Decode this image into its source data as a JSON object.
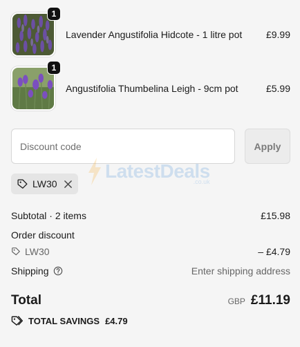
{
  "line_items": [
    {
      "name": "Lavender Angustifolia Hidcote - 1 litre pot",
      "price": "£9.99",
      "quantity": "1",
      "image": "lavender-hidcote-photo"
    },
    {
      "name": "Angustifolia Thumbelina Leigh - 9cm pot",
      "price": "£5.99",
      "quantity": "1",
      "image": "lavender-thumbelina-photo"
    }
  ],
  "discount": {
    "placeholder": "Discount code",
    "value": "",
    "apply_label": "Apply",
    "applied_code": "LW30"
  },
  "summary": {
    "subtotal_label": "Subtotal · 2 items",
    "subtotal_value": "£15.98",
    "order_discount_label": "Order discount",
    "order_discount_code": "LW30",
    "order_discount_value": "– £4.79",
    "shipping_label": "Shipping",
    "shipping_value": "Enter shipping address",
    "total_label": "Total",
    "currency": "GBP",
    "total_value": "£11.19",
    "savings_label": "TOTAL SAVINGS",
    "savings_value": "£4.79"
  },
  "watermark": {
    "text": "LatestDeals",
    "sub": ".co.uk"
  },
  "icons": {
    "tag": "tag-icon",
    "close": "close-icon",
    "help": "help-circle-icon",
    "savings": "savings-tag-icon"
  },
  "colors": {
    "background": "#f5f5f5",
    "badge": "#111111",
    "chip": "#e5e5e5",
    "apply_button": "#ececec"
  }
}
